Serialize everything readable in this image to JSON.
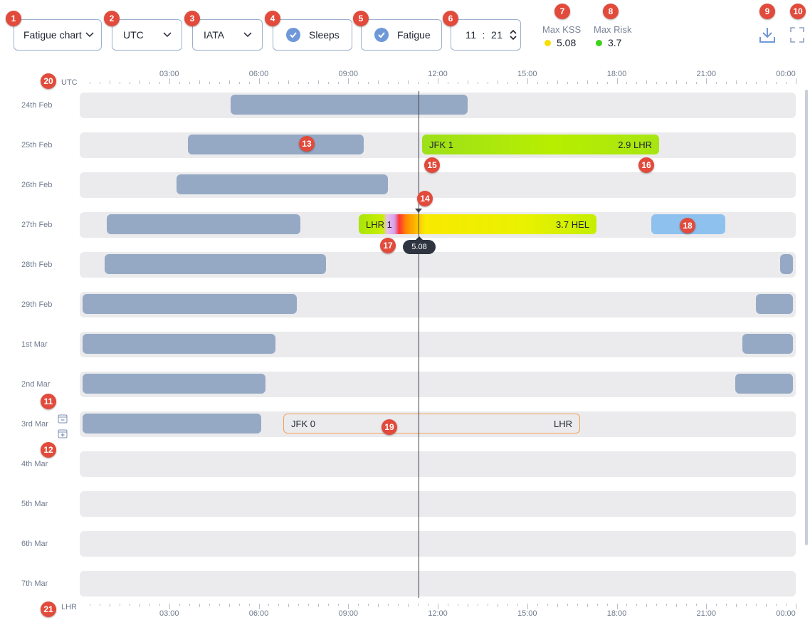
{
  "toolbar": {
    "chart_select": "Fatigue chart",
    "timezone_select": "UTC",
    "code_select": "IATA",
    "sleeps_toggle": "Sleeps",
    "fatigue_toggle": "Fatigue",
    "time_hours": "11",
    "time_sep": ":",
    "time_minutes": "21",
    "max_kss_label": "Max KSS",
    "max_kss_value": "5.08",
    "max_kss_color": "#f5e000",
    "max_risk_label": "Max Risk",
    "max_risk_value": "3.7",
    "max_risk_color": "#3fd11e",
    "download_icon": "download-icon",
    "fullscreen_icon": "fullscreen-icon"
  },
  "axis_top": {
    "zone": "UTC",
    "ticks": [
      "03:00",
      "06:00",
      "09:00",
      "12:00",
      "15:00",
      "18:00",
      "21:00",
      "00:00"
    ]
  },
  "axis_bottom": {
    "zone": "LHR",
    "ticks": [
      "03:00",
      "06:00",
      "09:00",
      "12:00",
      "15:00",
      "18:00",
      "21:00",
      "00:00"
    ]
  },
  "rows": [
    {
      "date": "24th Feb"
    },
    {
      "date": "25th Feb",
      "duty": {
        "from": "JFK",
        "from_count": "1",
        "to": "LHR",
        "risk": "2.9"
      }
    },
    {
      "date": "26th Feb"
    },
    {
      "date": "27th Feb",
      "duty": {
        "from": "LHR",
        "from_count": "1",
        "to": "HEL",
        "risk": "3.7"
      }
    },
    {
      "date": "28th Feb"
    },
    {
      "date": "29th Feb"
    },
    {
      "date": "1st Mar"
    },
    {
      "date": "2nd Mar"
    },
    {
      "date": "3rd Mar",
      "duty": {
        "from": "JFK",
        "from_count": "0",
        "to": "LHR"
      }
    },
    {
      "date": "4th Mar"
    },
    {
      "date": "5th Mar"
    },
    {
      "date": "6th Mar"
    },
    {
      "date": "7th Mar"
    }
  ],
  "cursor": {
    "time": "11:21",
    "kss_tooltip": "5.08"
  },
  "badges": [
    "1",
    "2",
    "3",
    "4",
    "5",
    "6",
    "7",
    "8",
    "9",
    "10",
    "11",
    "12",
    "13",
    "14",
    "15",
    "16",
    "17",
    "18",
    "19",
    "20",
    "21"
  ]
}
